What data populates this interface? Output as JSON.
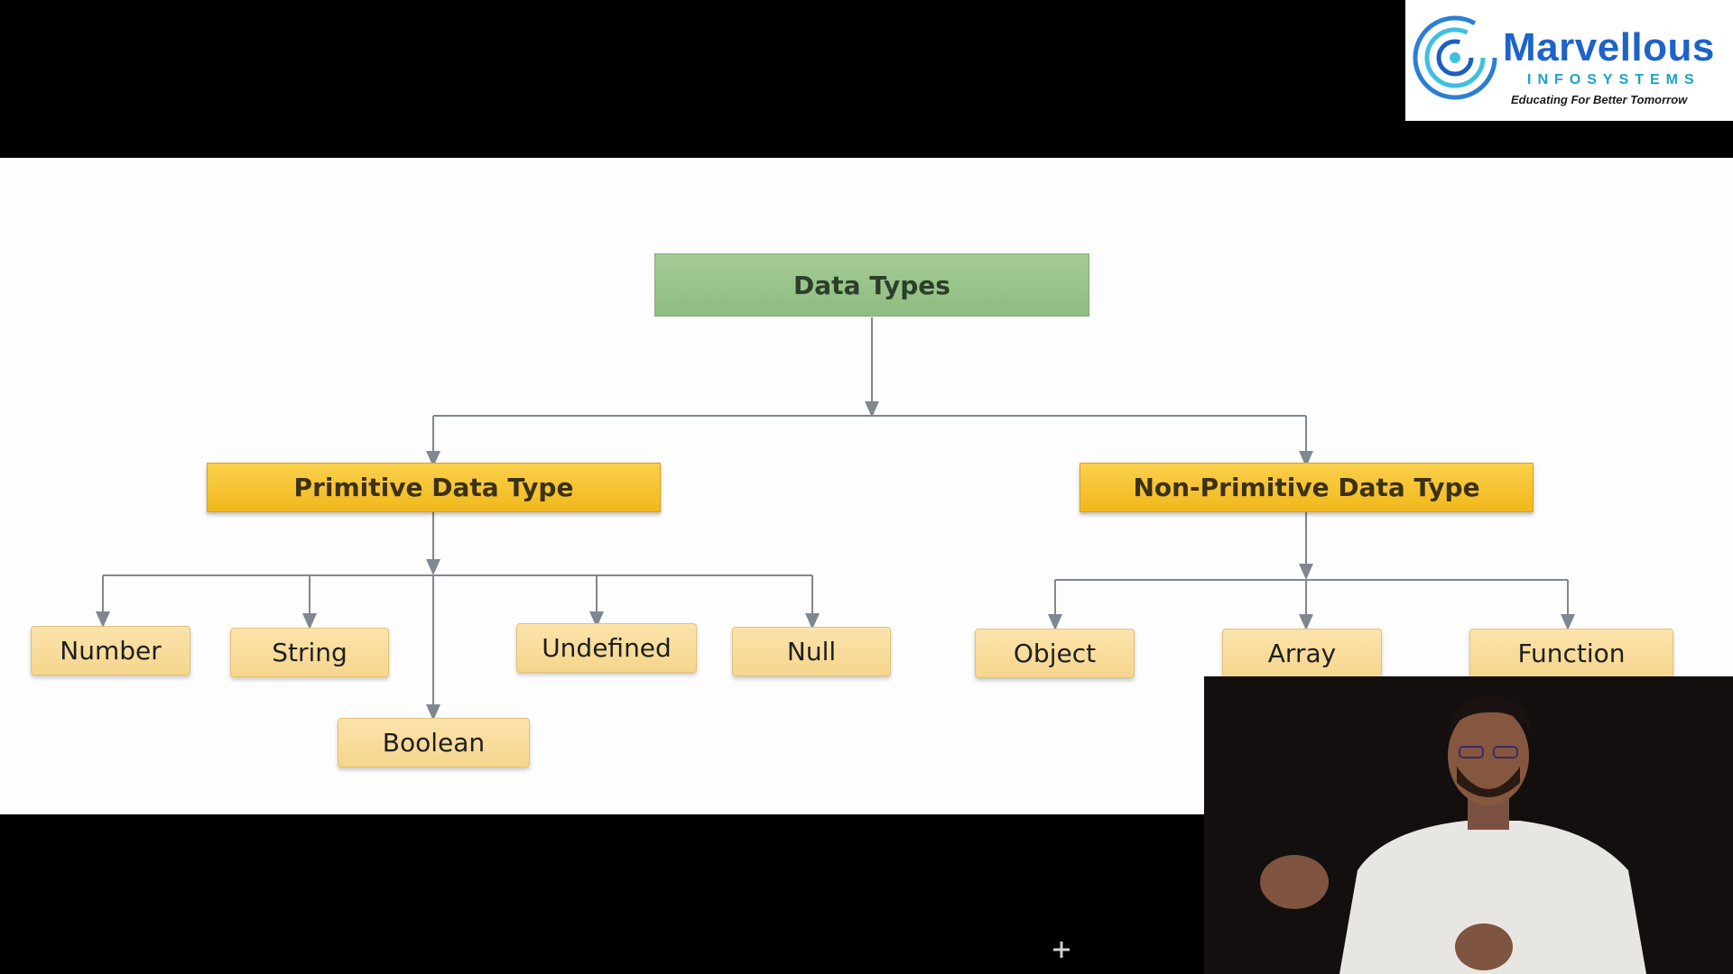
{
  "logo": {
    "brand": "Marvellous",
    "subtitle": "INFOSYSTEMS",
    "tagline": "Educating For Better Tomorrow",
    "colors": {
      "primary": "#1e63c8",
      "secondary": "#1aa3c8"
    }
  },
  "diagram": {
    "root": "Data Types",
    "primitive": {
      "label": "Primitive Data Type",
      "children": [
        "Number",
        "String",
        "Boolean",
        "Undefined",
        "Null"
      ]
    },
    "non_primitive": {
      "label": "Non-Primitive Data Type",
      "children": [
        "Object",
        "Array",
        "Function"
      ]
    },
    "colors": {
      "root": "#9ec58e",
      "group": "#f6c02b",
      "leaf": "#f9dd9c",
      "connector": "#7f8791"
    }
  },
  "video": {
    "icon": "presenter-video-icon"
  },
  "cursor": {
    "icon": "crosshair-cursor-icon"
  }
}
